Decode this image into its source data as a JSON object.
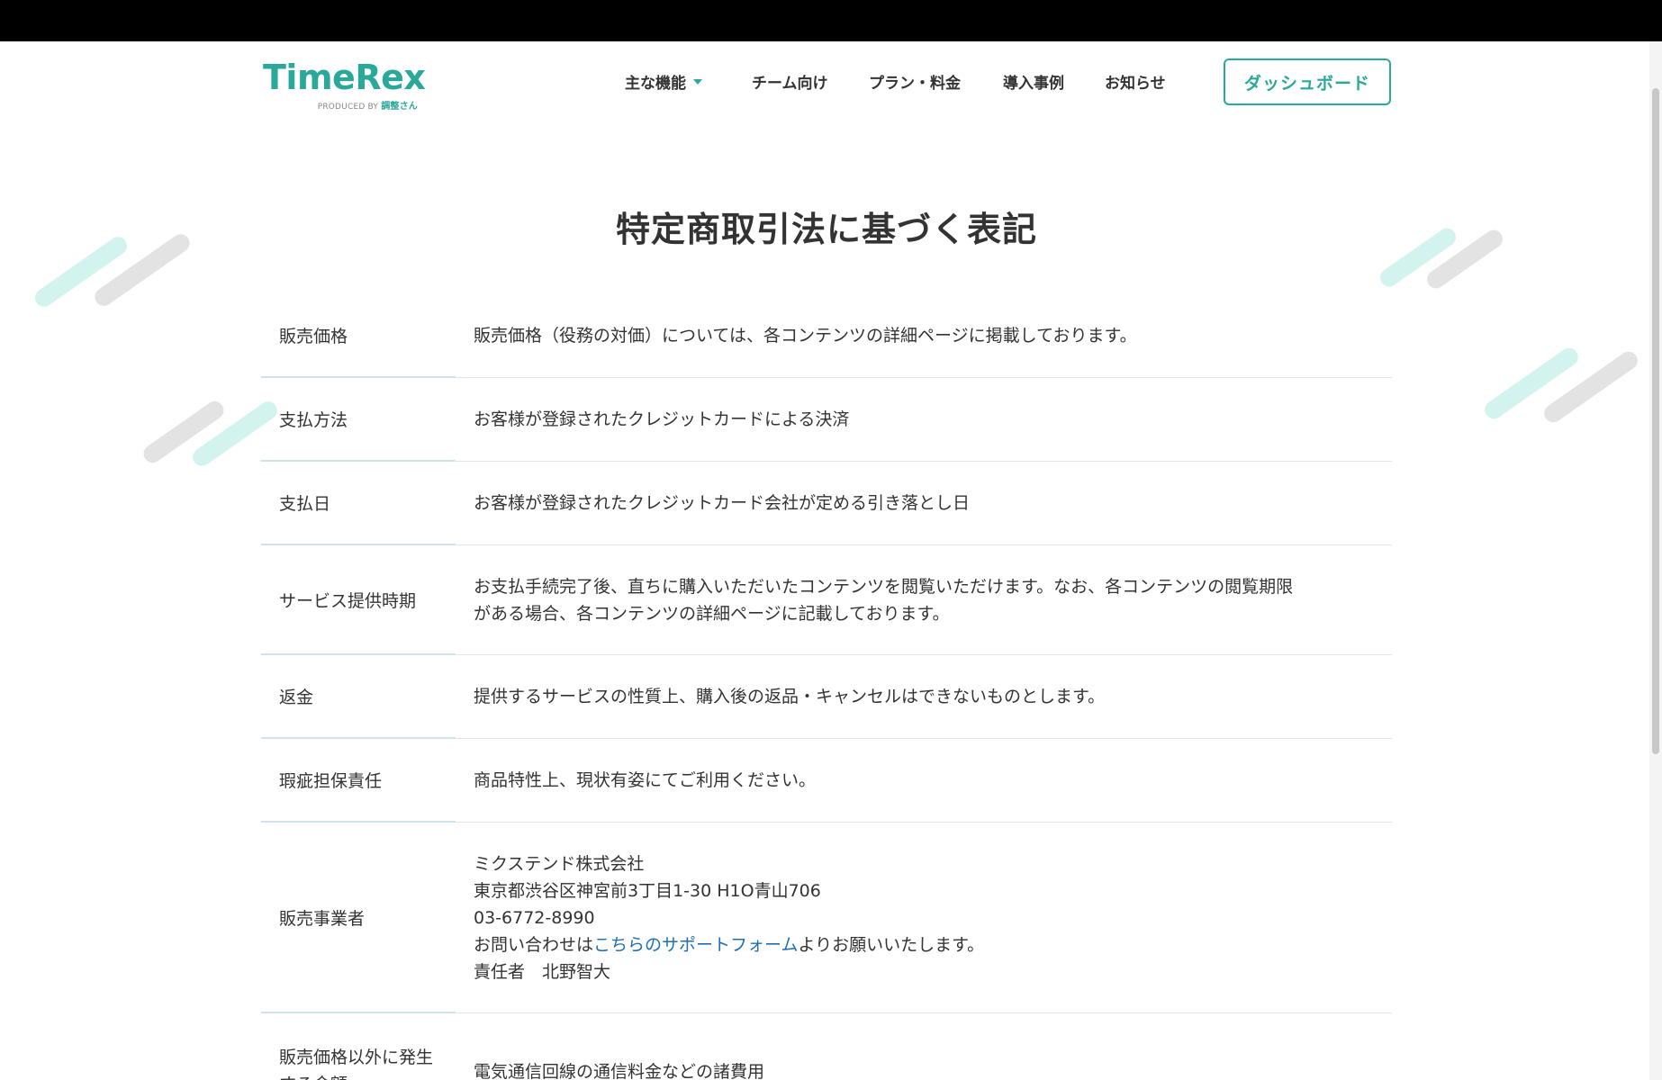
{
  "header": {
    "logo": {
      "name": "TimeRex",
      "produced_by": "PRODUCED BY",
      "brand": "調整さん"
    },
    "nav": [
      {
        "label": "主な機能",
        "has_dropdown": true
      },
      {
        "label": "チーム向け"
      },
      {
        "label": "プラン・料金"
      },
      {
        "label": "導入事例"
      },
      {
        "label": "お知らせ"
      }
    ],
    "dashboard_button": "ダッシュボード"
  },
  "page_title": "特定商取引法に基づく表記",
  "rows": [
    {
      "head": "販売価格",
      "lines": [
        "販売価格（役務の対価）については、各コンテンツの詳細ページに掲載しております。"
      ]
    },
    {
      "head": "支払方法",
      "lines": [
        "お客様が登録されたクレジットカードによる決済"
      ]
    },
    {
      "head": "支払日",
      "lines": [
        "お客様が登録されたクレジットカード会社が定める引き落とし日"
      ]
    },
    {
      "head": "サービス提供時期",
      "lines": [
        "お支払手続完了後、直ちに購入いただいたコンテンツを閲覧いただけます。なお、各コンテンツの閲覧期限",
        "がある場合、各コンテンツの詳細ページに記載しております。"
      ]
    },
    {
      "head": "返金",
      "lines": [
        "提供するサービスの性質上、購入後の返品・キャンセルはできないものとします。"
      ]
    },
    {
      "head": "瑕疵担保責任",
      "lines": [
        "商品特性上、現状有姿にてご利用ください。"
      ]
    },
    {
      "head": "販売事業者",
      "lines": [
        "ミクステンド株式会社",
        "東京都渋谷区神宮前3丁目1-30 H1O青山706",
        "03-6772-8990"
      ],
      "contact": {
        "prefix": "お問い合わせは",
        "link": "こちらのサポートフォーム",
        "suffix": "よりお願いいたします。"
      },
      "responsible": "責任者　北野智大"
    },
    {
      "head": "販売価格以外に発生する金額",
      "lines": [
        "電気通信回線の通信料金などの諸費用"
      ]
    }
  ],
  "colors": {
    "accent": "#2aa89a",
    "link": "#1f6fb6",
    "text": "#333333"
  }
}
